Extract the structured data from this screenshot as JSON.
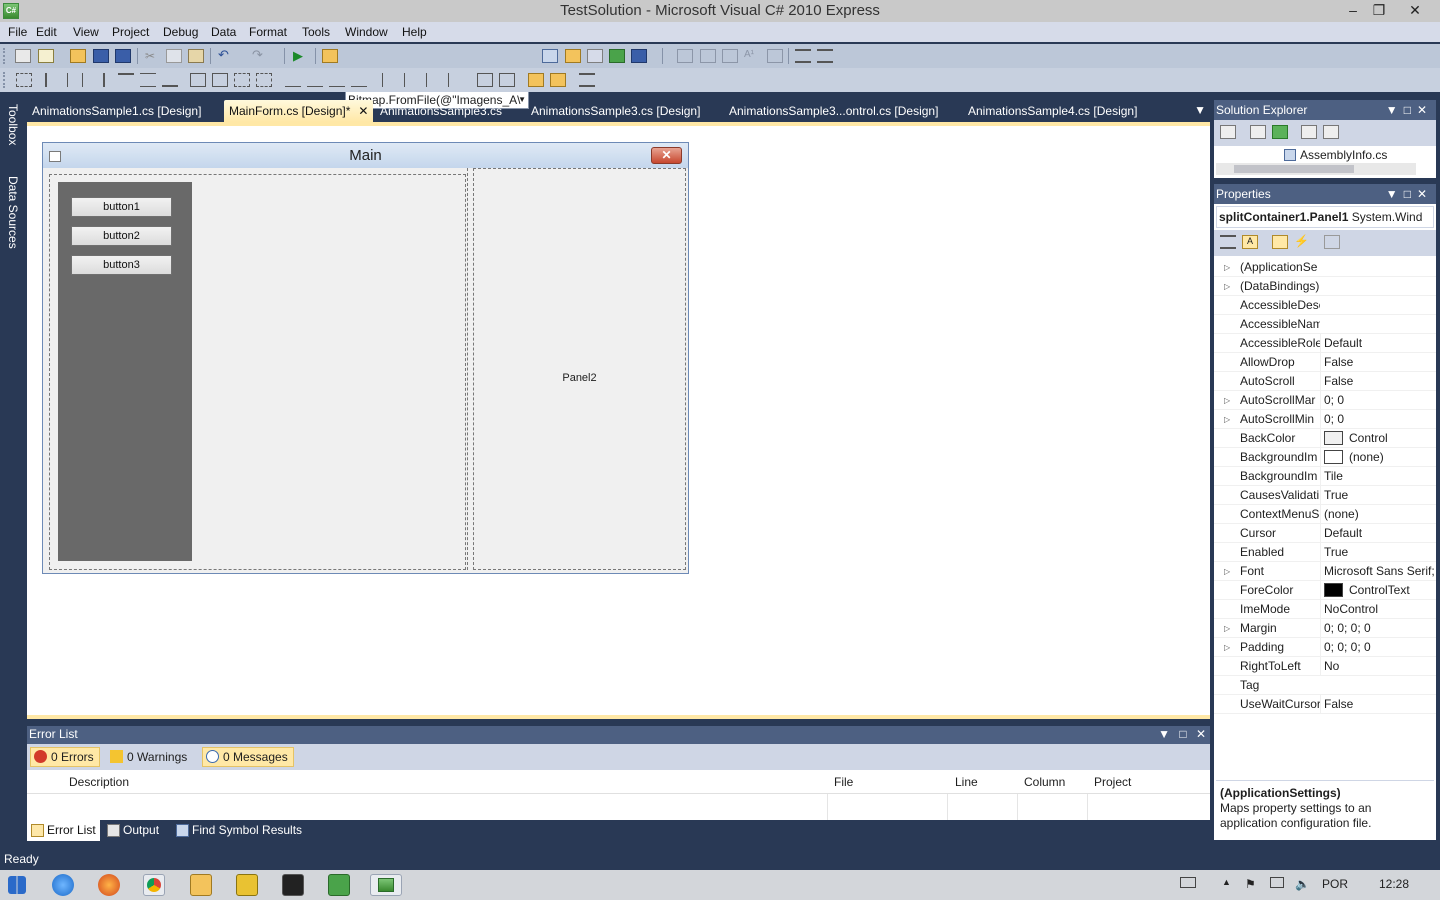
{
  "window": {
    "title": "TestSolution - Microsoft Visual C# 2010 Express"
  },
  "menu": [
    "File",
    "Edit",
    "View",
    "Project",
    "Debug",
    "Data",
    "Format",
    "Tools",
    "Window",
    "Help"
  ],
  "toolbar": {
    "find_combo_value": "Bitmap.FromFile(@\"Imagens_A\\"
  },
  "left_dock": {
    "toolbox": "Toolbox",
    "data_sources": "Data Sources"
  },
  "doc_tabs": [
    "AnimationsSample1.cs [Design]",
    "MainForm.cs [Design]*",
    "AnimationsSample3.cs",
    "AnimationsSample3.cs [Design]",
    "AnimationsSample3...ontrol.cs [Design]",
    "AnimationsSample4.cs [Design]"
  ],
  "form": {
    "title": "Main",
    "buttons": [
      "button1",
      "button2",
      "button3"
    ],
    "panel2_label": "Panel2"
  },
  "error_list": {
    "title": "Error List",
    "filters": {
      "errors": "0 Errors",
      "warnings": "0 Warnings",
      "messages": "0 Messages"
    },
    "columns": {
      "description": "Description",
      "file": "File",
      "line": "Line",
      "column": "Column",
      "project": "Project"
    }
  },
  "bottom_tabs": [
    "Error List",
    "Output",
    "Find Symbol Results"
  ],
  "solution_explorer": {
    "title": "Solution Explorer",
    "item": "AssemblyInfo.cs"
  },
  "properties": {
    "title": "Properties",
    "object_name": "splitContainer1.Panel1",
    "object_type": "System.Wind",
    "rows": [
      {
        "name": "(ApplicationSe",
        "value": "",
        "expandable": true
      },
      {
        "name": "(DataBindings)",
        "value": "",
        "expandable": true
      },
      {
        "name": "AccessibleDesc",
        "value": ""
      },
      {
        "name": "AccessibleNam",
        "value": ""
      },
      {
        "name": "AccessibleRole",
        "value": "Default"
      },
      {
        "name": "AllowDrop",
        "value": "False"
      },
      {
        "name": "AutoScroll",
        "value": "False"
      },
      {
        "name": "AutoScrollMar",
        "value": "0; 0",
        "expandable": true
      },
      {
        "name": "AutoScrollMin",
        "value": "0; 0",
        "expandable": true
      },
      {
        "name": "BackColor",
        "value": "Control",
        "swatch": "#f0f0f0"
      },
      {
        "name": "BackgroundIm",
        "value": "(none)",
        "swatch": "#ffffff"
      },
      {
        "name": "BackgroundIm",
        "value": "Tile"
      },
      {
        "name": "CausesValidati",
        "value": "True"
      },
      {
        "name": "ContextMenuS",
        "value": "(none)"
      },
      {
        "name": "Cursor",
        "value": "Default"
      },
      {
        "name": "Enabled",
        "value": "True"
      },
      {
        "name": "Font",
        "value": "Microsoft Sans Serif;",
        "expandable": true
      },
      {
        "name": "ForeColor",
        "value": "ControlText",
        "swatch": "#000000"
      },
      {
        "name": "ImeMode",
        "value": "NoControl"
      },
      {
        "name": "Margin",
        "value": "0; 0; 0; 0",
        "expandable": true
      },
      {
        "name": "Padding",
        "value": "0; 0; 0; 0",
        "expandable": true
      },
      {
        "name": "RightToLeft",
        "value": "No"
      },
      {
        "name": "Tag",
        "value": ""
      },
      {
        "name": "UseWaitCursor",
        "value": "False"
      }
    ],
    "description_title": "(ApplicationSettings)",
    "description_text": "Maps property settings to an application configuration file."
  },
  "status": {
    "text": "Ready"
  },
  "taskbar": {
    "language": "POR",
    "time": "12:28"
  },
  "colors": {
    "ide_background": "#293955",
    "active_tab": "#ffe8a6",
    "panel_header": "#4d6082"
  }
}
